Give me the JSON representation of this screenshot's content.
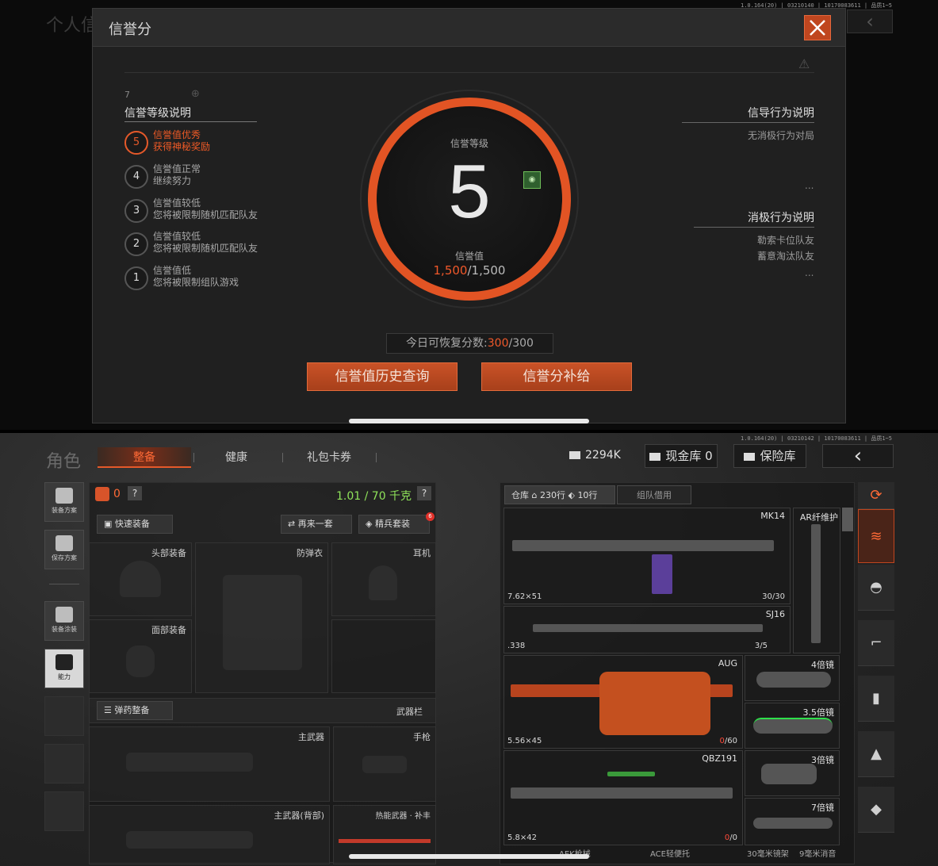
{
  "top": {
    "version": "1.0.164(20) | 03210140 | 10170083611 | 品质1~5",
    "bg_title": "个人信",
    "modal": {
      "title": "信誉分",
      "level_section_title": "信誉等级说明",
      "levels": [
        {
          "num": "5",
          "line1": "信誉值优秀",
          "line2": "获得神秘奖励"
        },
        {
          "num": "4",
          "line1": "信誉值正常",
          "line2": "继续努力"
        },
        {
          "num": "3",
          "line1": "信誉值较低",
          "line2": "您将被限制随机匹配队友"
        },
        {
          "num": "2",
          "line1": "信誉值较低",
          "line2": "您将被限制随机匹配队友"
        },
        {
          "num": "1",
          "line1": "信誉值低",
          "line2": "您将被限制组队游戏"
        }
      ],
      "gauge": {
        "level_label": "信誉等级",
        "level": "5",
        "value_label": "信誉值",
        "value_current": "1,500",
        "value_max": "/1,500"
      },
      "guide_title": "信导行为说明",
      "guide_items": [
        "无消极行为对局"
      ],
      "negative_title": "消极行为说明",
      "negative_items": [
        "勒索卡位队友",
        "蓄意淘汰队友"
      ],
      "more": "...",
      "recover_label": "今日可恢复分数:",
      "recover_current": "300",
      "recover_max": "/300",
      "history_btn": "信誉值历史查询",
      "supply_btn": "信誉分补给"
    }
  },
  "bottom": {
    "version": "1.0.164(20) | 03210142 | 10170083611 | 品质1~5",
    "role_title": "角色",
    "tabs": [
      "整备",
      "健康",
      "礼包卡券"
    ],
    "currency": "2294K",
    "cash_vault": "现金库 0",
    "safe_box": "保险库",
    "side_buttons": [
      "装备方案",
      "保存方案",
      "装备涂装",
      "能力"
    ],
    "armor_count": "0",
    "weight": "1.01 / 70 千克",
    "help": "?",
    "quick_equip": "快速装备",
    "again": "再来一套",
    "elite": "精兵套装",
    "elite_badge": "6",
    "slots": {
      "head": "头部装备",
      "vest": "防弹衣",
      "ear": "耳机",
      "face": "面部装备"
    },
    "ammo_equip": "弹药整备",
    "weapon_bar": "武器栏",
    "weapon_slots": {
      "primary": "主武器",
      "pistol": "手枪",
      "primary_back": "主武器(背部)",
      "melee": "热能武器 · 补丰"
    },
    "inventory": {
      "tab": "仓库",
      "rows": "230行",
      "rows2": "10行",
      "team_borrow": "组队借用"
    },
    "items": [
      {
        "name": "MK14",
        "cal": "7.62×51",
        "ammo": "30/30"
      },
      {
        "name": "AR纤维护",
        "cal": "",
        "ammo": ""
      },
      {
        "name": "SJ16",
        "cal": ".338",
        "ammo": "3/5"
      },
      {
        "name": "AUG",
        "cal": "5.56×45",
        "ammo_red": "0",
        "ammo_rest": "/60"
      },
      {
        "name": "4倍镜",
        "cal": "",
        "ammo": ""
      },
      {
        "name": "3.5倍镜",
        "cal": "",
        "ammo": ""
      },
      {
        "name": "QBZ191",
        "cal": "5.8×42",
        "ammo_red": "0",
        "ammo_rest": "/0"
      },
      {
        "name": "3倍镜",
        "cal": "",
        "ammo": ""
      },
      {
        "name": "7倍镜",
        "cal": "",
        "ammo": ""
      }
    ],
    "bottom_row": [
      "AEK枪械",
      "ACE轻便托",
      "30毫米镜架",
      "9毫米消音"
    ]
  }
}
